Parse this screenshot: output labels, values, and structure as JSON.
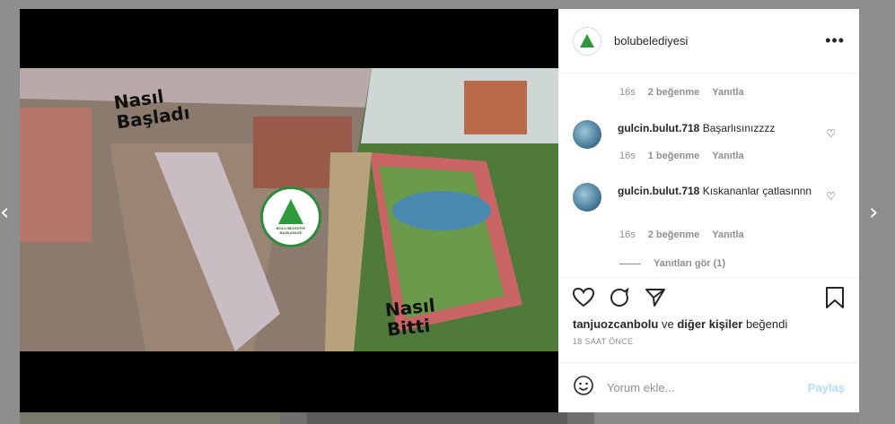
{
  "post": {
    "username": "bolubelediyesi",
    "media": {
      "top_text": [
        "Nasıl",
        "Başladı"
      ],
      "bottom_text": [
        "Nasıl",
        "Bitti"
      ],
      "logo_label": "BOLU BELEDİYE BAŞKANLIĞI"
    }
  },
  "comments": {
    "first_meta": {
      "time": "16s",
      "likes": "2 beğenme",
      "reply": "Yanıtla"
    },
    "items": [
      {
        "user": "gulcin.bulut.718",
        "text": "Başarlısınızzzz",
        "time": "16s",
        "likes": "1 beğenme",
        "reply": "Yanıtla"
      },
      {
        "user": "gulcin.bulut.718",
        "text": "Kıskananlar çatlasınnn",
        "time": "16s",
        "likes": "2 beğenme",
        "reply": "Yanıtla"
      }
    ],
    "view_replies": "Yanıtları gör (1)"
  },
  "likes": {
    "user": "tanjuozcanbolu",
    "connector": "ve",
    "others": "diğer kişiler",
    "suffix": "beğendi"
  },
  "timestamp": "18 SAAT ÖNCE",
  "add_comment": {
    "placeholder": "Yorum ekle...",
    "post_label": "Paylaş"
  },
  "icons": {
    "more": "more-options-icon",
    "like": "heart-icon",
    "comment": "comment-icon",
    "share": "share-icon",
    "save": "bookmark-icon",
    "emoji": "emoji-icon",
    "prev": "chevron-left-icon",
    "next": "chevron-right-icon"
  },
  "colors": {
    "accent": "#0095f6",
    "post_disabled": "#b3dbff"
  }
}
